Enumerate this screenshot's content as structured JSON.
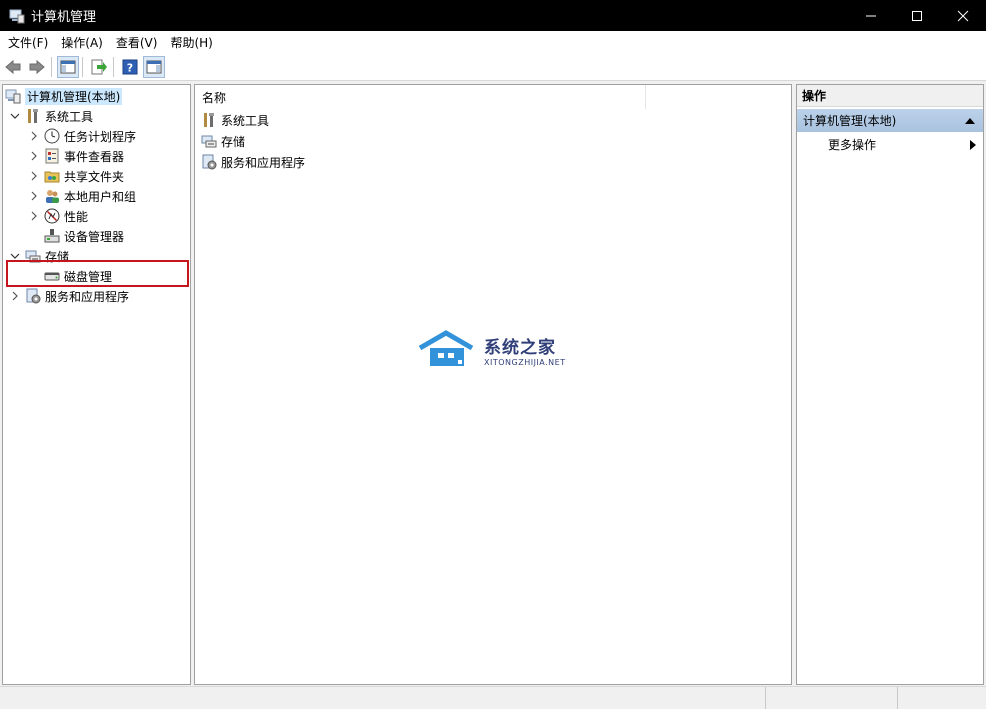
{
  "window": {
    "title": "计算机管理",
    "minimize_glyph": "—",
    "maximize_glyph": "☐",
    "close_glyph": "✕"
  },
  "menubar": {
    "items": [
      "文件(F)",
      "操作(A)",
      "查看(V)",
      "帮助(H)"
    ]
  },
  "toolbar": {
    "buttons": [
      "back-arrow-icon",
      "forward-arrow-icon",
      "show-hide-console-tree-icon",
      "export-list-icon",
      "help-icon",
      "show-hide-action-pane-icon"
    ]
  },
  "tree": {
    "root": "计算机管理(本地)",
    "system_tools": "系统工具",
    "task_scheduler": "任务计划程序",
    "event_viewer": "事件查看器",
    "shared_folders": "共享文件夹",
    "local_users": "本地用户和组",
    "performance": "性能",
    "device_manager": "设备管理器",
    "storage": "存储",
    "disk_management": "磁盘管理",
    "services_apps": "服务和应用程序"
  },
  "center": {
    "column_header": "名称",
    "items": [
      "系统工具",
      "存储",
      "服务和应用程序"
    ]
  },
  "actions": {
    "header": "操作",
    "section": "计算机管理(本地)",
    "more": "更多操作"
  },
  "watermark": {
    "main": "系统之家",
    "sub": "XITONGZHIJIA.NET"
  },
  "colors": {
    "highlight": "#c4161c",
    "selection": "#cce8ff",
    "section_band": "#bcd2ea"
  }
}
